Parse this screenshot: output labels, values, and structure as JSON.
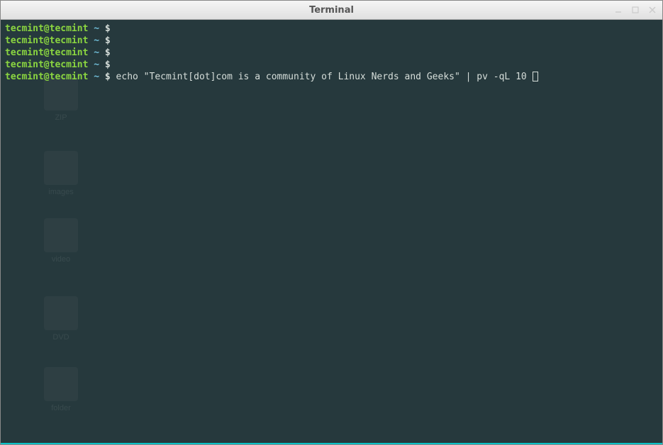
{
  "window": {
    "title": "Terminal"
  },
  "terminal": {
    "prompt_user": "tecmint@tecmint",
    "prompt_path": "~",
    "prompt_symbol": "$",
    "lines": [
      {
        "command": ""
      },
      {
        "command": ""
      },
      {
        "command": ""
      },
      {
        "command": ""
      },
      {
        "command": "echo \"Tecmint[dot]com is a community of Linux Nerds and Geeks\" | pv -qL 10"
      }
    ]
  },
  "desktop_ghosts": [
    {
      "label": "ZIP"
    },
    {
      "label": "images"
    },
    {
      "label": "video"
    },
    {
      "label": "DVD"
    },
    {
      "label": "folder"
    }
  ]
}
